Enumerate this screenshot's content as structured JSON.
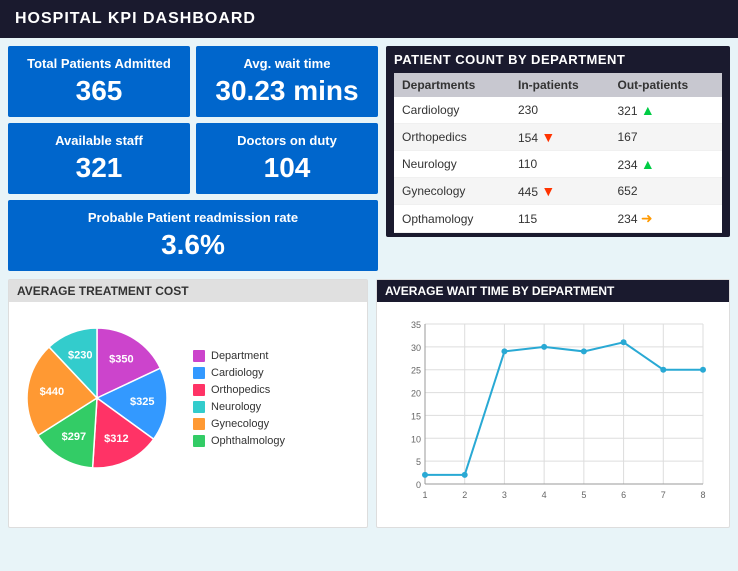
{
  "header": {
    "title": "HOSPITAL KPI DASHBOARD"
  },
  "kpis": {
    "total_patients_label": "Total Patients Admitted",
    "total_patients_value": "365",
    "avg_wait_label": "Avg. wait time",
    "avg_wait_value": "30.23 mins",
    "available_staff_label": "Available staff",
    "available_staff_value": "321",
    "doctors_on_duty_label": "Doctors on duty",
    "doctors_on_duty_value": "104",
    "readmission_label": "Probable Patient readmission rate",
    "readmission_value": "3.6%"
  },
  "patient_count": {
    "title": "PATIENT COUNT BY DEPARTMENT",
    "columns": [
      "Departments",
      "In-patients",
      "Out-patients"
    ],
    "rows": [
      {
        "dept": "Cardiology",
        "in": "230",
        "out": "321",
        "arrow": "up"
      },
      {
        "dept": "Orthopedics",
        "in": "154",
        "out": "167",
        "arrow": "down"
      },
      {
        "dept": "Neurology",
        "in": "110",
        "out": "234",
        "arrow": "up"
      },
      {
        "dept": "Gynecology",
        "in": "445",
        "out": "652",
        "arrow": "down"
      },
      {
        "dept": "Opthamology",
        "in": "115",
        "out": "234",
        "arrow": "right"
      }
    ]
  },
  "avg_treatment_cost": {
    "title": "AVERAGE TREATMENT COST",
    "legend": [
      {
        "label": "Department",
        "color": "#cc44cc"
      },
      {
        "label": "Cardiology",
        "color": "#3399ff"
      },
      {
        "label": "Orthopedics",
        "color": "#ff3366"
      },
      {
        "label": "Neurology",
        "color": "#33cccc"
      },
      {
        "label": "Gynecology",
        "color": "#ff9933"
      },
      {
        "label": "Ophthalmology",
        "color": "#33cc66"
      }
    ],
    "slices": [
      {
        "label": "$350",
        "color": "#cc44cc",
        "percent": 18
      },
      {
        "label": "$325",
        "color": "#3399ff",
        "percent": 17
      },
      {
        "label": "$312",
        "color": "#ff3366",
        "percent": 16
      },
      {
        "label": "$297",
        "color": "#33cc66",
        "percent": 15
      },
      {
        "label": "$440",
        "color": "#ff9933",
        "percent": 22
      },
      {
        "label": "$230",
        "color": "#33cccc",
        "percent": 12
      }
    ]
  },
  "avg_wait_time": {
    "title": "AVERAGE WAIT TIME BY DEPARTMENT",
    "y_max": 35,
    "y_labels": [
      35,
      30,
      25,
      20,
      15,
      10,
      5
    ],
    "x_labels": [
      1,
      2,
      3,
      4,
      5,
      6,
      7,
      8
    ],
    "data_points": [
      {
        "x": 1,
        "y": 2
      },
      {
        "x": 2,
        "y": 2
      },
      {
        "x": 3,
        "y": 29
      },
      {
        "x": 4,
        "y": 30
      },
      {
        "x": 5,
        "y": 29
      },
      {
        "x": 6,
        "y": 31
      },
      {
        "x": 7,
        "y": 25
      },
      {
        "x": 8,
        "y": 25
      }
    ]
  }
}
